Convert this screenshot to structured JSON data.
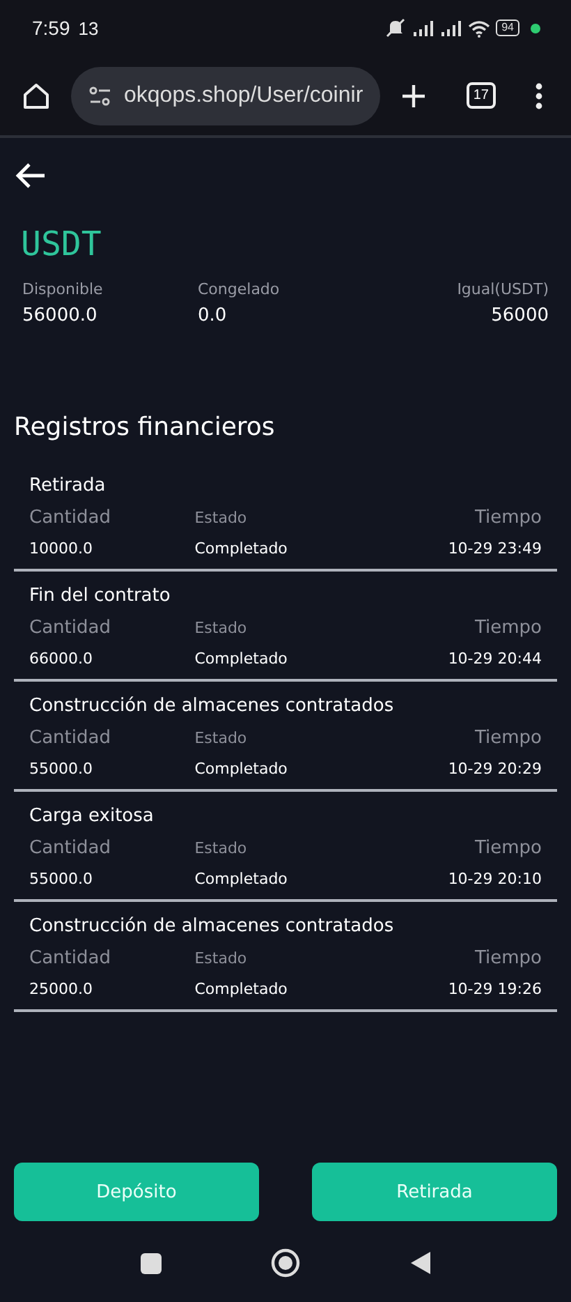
{
  "status_bar": {
    "time": "7:59",
    "extra": "13",
    "battery": "94"
  },
  "browser": {
    "url": "okqops.shop/User/coinir",
    "tab_count": "17"
  },
  "currency": "USDT",
  "balances": [
    {
      "label": "Disponible",
      "value": "56000.0"
    },
    {
      "label": "Congelado",
      "value": "0.0"
    },
    {
      "label": "Igual(USDT)",
      "value": "56000"
    }
  ],
  "section_title": "Registros financieros",
  "records": [
    {
      "title": "Retirada",
      "amount_label": "Cantidad",
      "status_label": "Estado",
      "time_label": "Tiempo",
      "amount": "10000.0",
      "status": "Completado",
      "time": "10-29 23:49"
    },
    {
      "title": "Fin del contrato",
      "amount_label": "Cantidad",
      "status_label": "Estado",
      "time_label": "Tiempo",
      "amount": "66000.0",
      "status": "Completado",
      "time": "10-29 20:44"
    },
    {
      "title": "Construcción de almacenes contratados",
      "amount_label": "Cantidad",
      "status_label": "Estado",
      "time_label": "Tiempo",
      "amount": "55000.0",
      "status": "Completado",
      "time": "10-29 20:29"
    },
    {
      "title": "Carga exitosa",
      "amount_label": "Cantidad",
      "status_label": "Estado",
      "time_label": "Tiempo",
      "amount": "55000.0",
      "status": "Completado",
      "time": "10-29 20:10"
    },
    {
      "title": "Construcción de almacenes contratados",
      "amount_label": "Cantidad",
      "status_label": "Estado",
      "time_label": "Tiempo",
      "amount": "25000.0",
      "status": "Completado",
      "time": "10-29 19:26"
    }
  ],
  "buttons": [
    "Depósito",
    "Retirada"
  ]
}
